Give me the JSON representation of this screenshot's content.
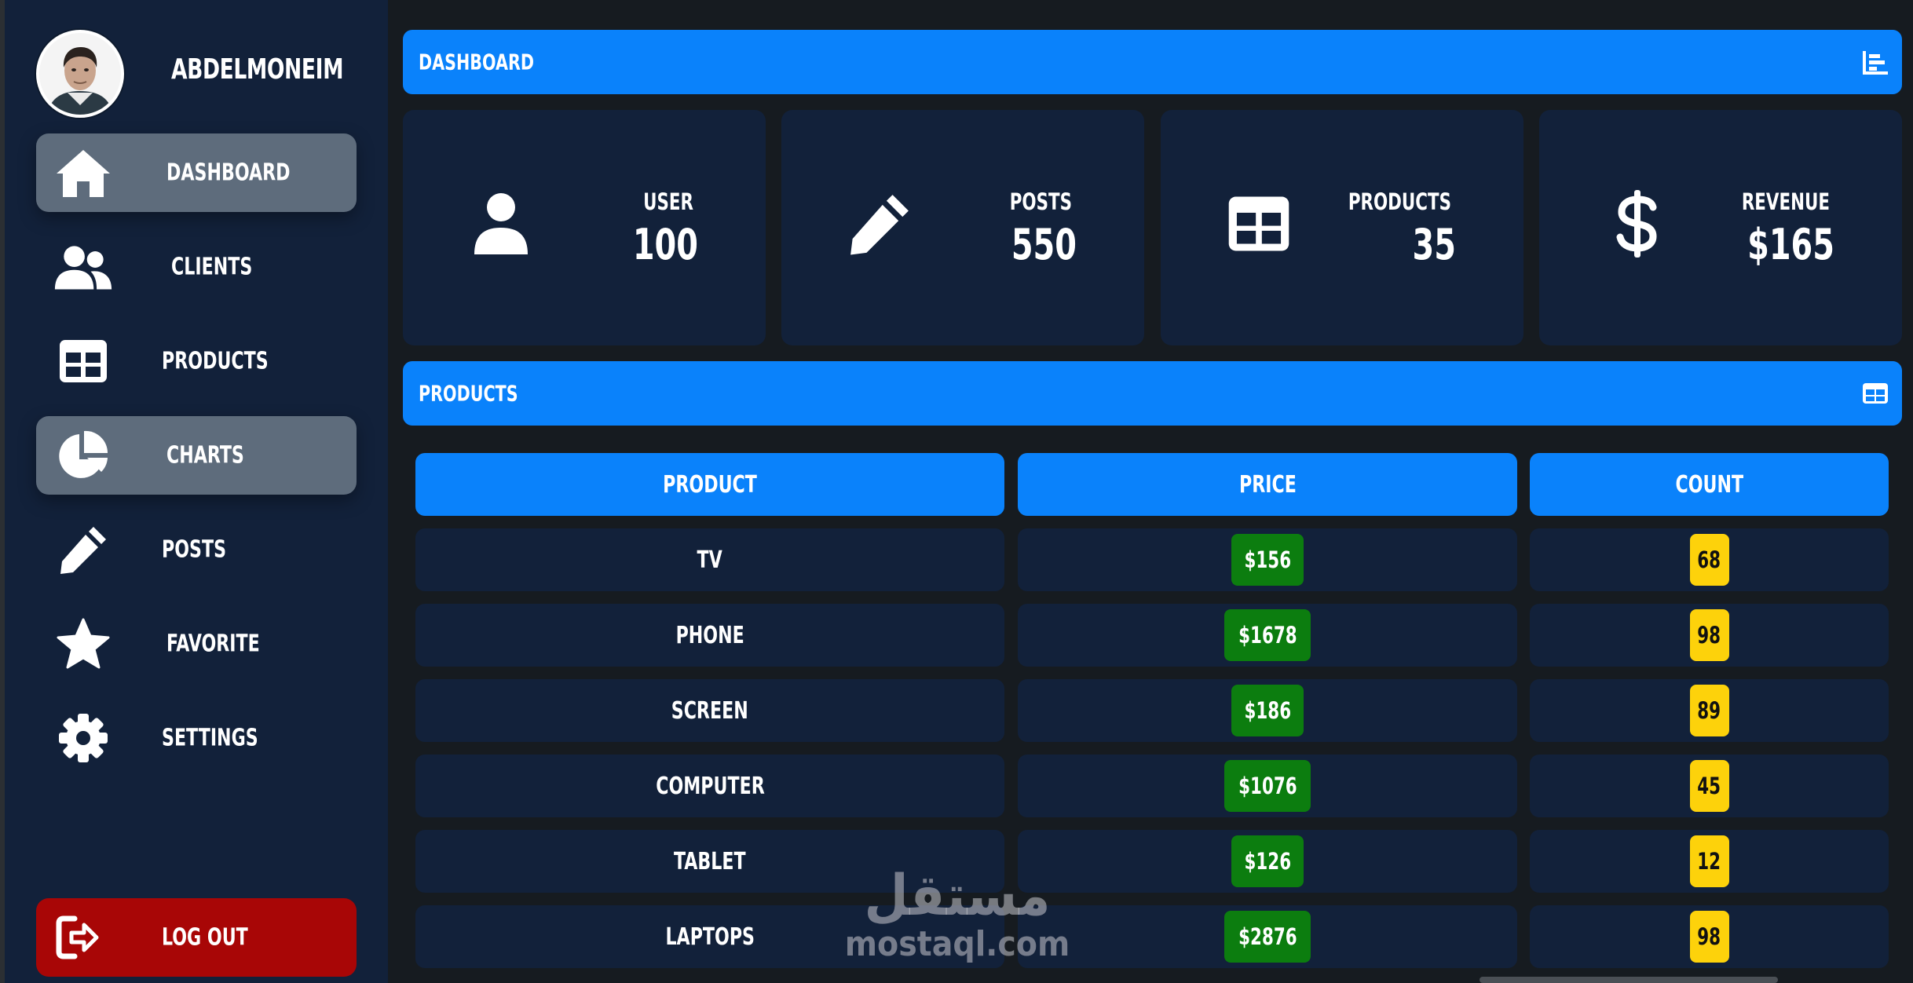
{
  "user": {
    "name": "ABDELMONEIM"
  },
  "sidebar": {
    "items": [
      {
        "label": "DASHBOARD",
        "icon": "home-icon"
      },
      {
        "label": "CLIENTS",
        "icon": "users-icon"
      },
      {
        "label": "PRODUCTS",
        "icon": "table-icon"
      },
      {
        "label": "CHARTS",
        "icon": "pie-chart-icon"
      },
      {
        "label": "POSTS",
        "icon": "pencil-icon"
      },
      {
        "label": "FAVORITE",
        "icon": "star-icon"
      },
      {
        "label": "SETTINGS",
        "icon": "gear-icon"
      }
    ],
    "logout": {
      "label": "LOG OUT",
      "icon": "sign-out-icon"
    }
  },
  "header": {
    "title": "DASHBOARD",
    "icon": "chart-bar-icon"
  },
  "stats": [
    {
      "label": "USER",
      "value": "100",
      "icon": "user-icon"
    },
    {
      "label": "POSTS",
      "value": "550",
      "icon": "pencil-icon"
    },
    {
      "label": "PRODUCTS",
      "value": "35",
      "icon": "table-icon"
    },
    {
      "label": "REVENUE",
      "value": "$165",
      "icon": "dollar-icon"
    }
  ],
  "products_section": {
    "title": "PRODUCTS",
    "icon": "table-icon"
  },
  "table": {
    "headers": [
      "PRODUCT",
      "PRICE",
      "COUNT"
    ],
    "rows": [
      {
        "product": "TV",
        "price": "$156",
        "count": "68"
      },
      {
        "product": "PHONE",
        "price": "$1678",
        "count": "98"
      },
      {
        "product": "SCREEN",
        "price": "$186",
        "count": "89"
      },
      {
        "product": "COMPUTER",
        "price": "$1076",
        "count": "45"
      },
      {
        "product": "TABLET",
        "price": "$126",
        "count": "12"
      },
      {
        "product": "LAPTOPS",
        "price": "$2876",
        "count": "98"
      }
    ]
  },
  "watermark": {
    "arabic": "مستقل",
    "latin": "mostaql.com"
  },
  "colors": {
    "accent": "#0a82fb",
    "panel": "#12213a",
    "price": "#0c7d0f",
    "count": "#fdd20b",
    "logout": "#a80606"
  }
}
